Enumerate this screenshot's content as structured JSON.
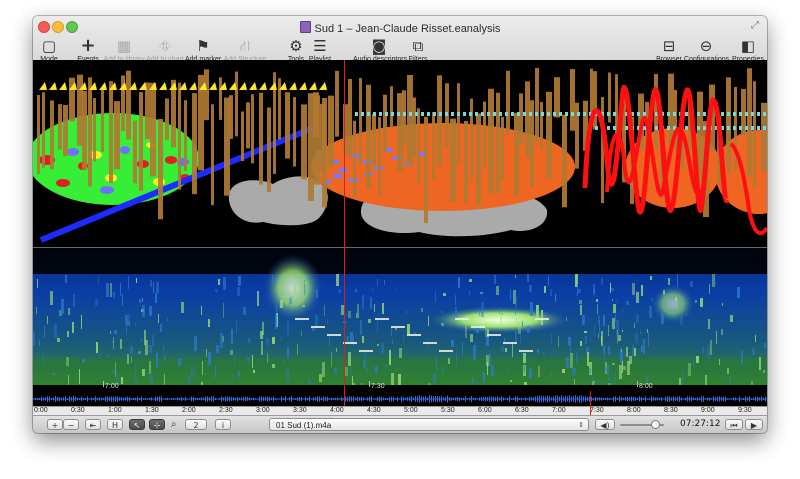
{
  "window": {
    "title": "Sud 1 – Jean-Claude Risset.eanalysis"
  },
  "toolbar": {
    "mode": "Mode",
    "events": "Events",
    "add_to_library": "Add to library",
    "add_to_chart": "Add to chart",
    "add_marker": "Add marker",
    "add_structure": "Add Structure",
    "tools": "Tools",
    "playlist": "Playlist",
    "audio_descriptors": "Audio descriptors",
    "filters": "Filters",
    "browser": "Browser",
    "configurations": "Configurations",
    "properties": "Properties"
  },
  "timeline": {
    "labels": [
      "7:00",
      "7:30",
      "8:00"
    ]
  },
  "ruler": {
    "labels": [
      "0:00",
      "0:30",
      "1:00",
      "1:30",
      "2:00",
      "2:30",
      "3:00",
      "3:30",
      "4:00",
      "4:30",
      "5:00",
      "5:30",
      "6:00",
      "6:30",
      "7:00",
      "7:30",
      "8:00",
      "8:30",
      "9:00",
      "9:30"
    ]
  },
  "bottombar": {
    "add": "+",
    "remove": "−",
    "rewind": "⇤",
    "marker_btn": "H",
    "arrow_btn": "↖",
    "select_btn": "⊹",
    "zoom_icon": "⌕",
    "page_value": "2",
    "info_btn": "i",
    "file_name": "01 Sud (1).m4a",
    "volume_icon": "◀)",
    "volume_level": 0.72,
    "time": "07:27:12",
    "prev": "⏮",
    "play": "▶"
  },
  "colors": {
    "background": "#000000",
    "playhead": "#e21c1c",
    "spectrogram_base": "#0a3aa0",
    "spectrogram_high": "#c8f0b0",
    "waveform": "#3a6ee0"
  },
  "icons": [
    "mode-icon",
    "events-icon",
    "library-icon",
    "chart-icon",
    "marker-flag-icon",
    "structure-icon",
    "tools-icon",
    "playlist-icon",
    "audio-descriptors-icon",
    "filters-icon",
    "browser-icon",
    "configurations-icon",
    "properties-icon"
  ]
}
